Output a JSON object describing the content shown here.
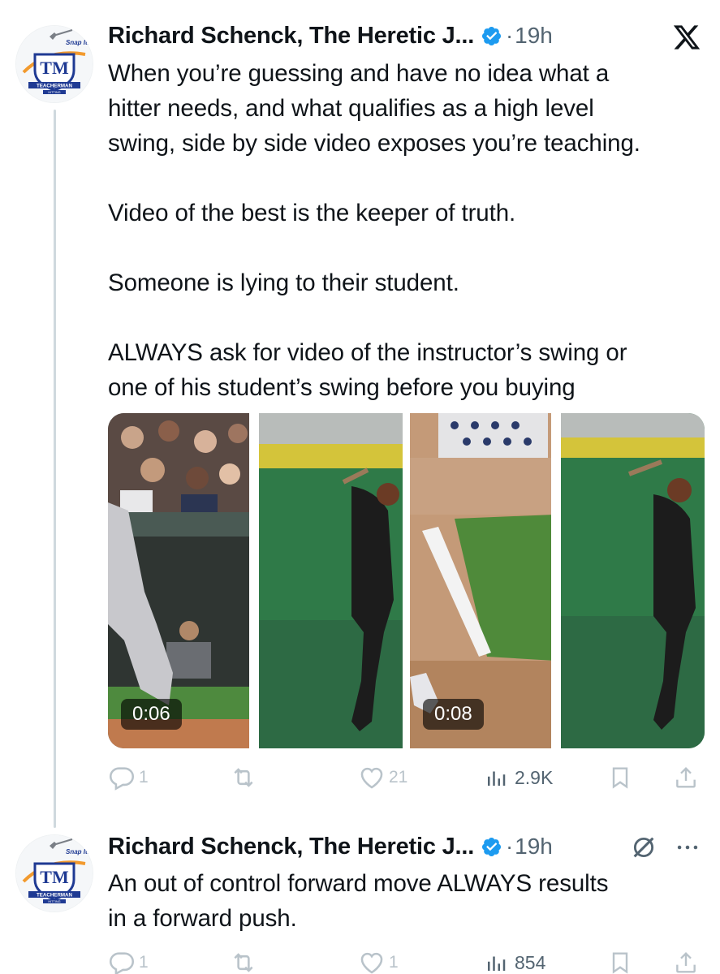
{
  "tweets": [
    {
      "author": "Richard Schenck, The Heretic J...",
      "time": "19h",
      "text": [
        "When you’re guessing and have no idea what a",
        "hitter needs, and what qualifies as a high level",
        "swing, side by side video exposes you’re teaching.",
        "",
        "Video of the best is the keeper of truth.",
        "",
        "Someone is lying to their student.",
        "",
        "ALWAYS ask for video of the instructor’s swing or",
        "one of his student’s swing before you buying"
      ],
      "videos": [
        {
          "duration": "0:06"
        },
        {
          "duration": "0:08"
        }
      ],
      "stats": {
        "replies": "1",
        "likes": "21",
        "views": "2.9K"
      }
    },
    {
      "author": "Richard Schenck, The Heretic J...",
      "time": "19h",
      "text": [
        "An out of control forward move ALWAYS results",
        "in a forward push."
      ],
      "stats": {
        "replies": "1",
        "likes": "1",
        "views": "854"
      }
    }
  ],
  "avatar": {
    "top_text": "Snap It!",
    "monogram": "TM",
    "banner": "TEACHERMAN",
    "sub": "HITTING"
  },
  "colors": {
    "verified": "#1d9bf0",
    "muted": "#536471",
    "action_faded": "#b9c3ca",
    "thread_line": "#cfd9de"
  }
}
